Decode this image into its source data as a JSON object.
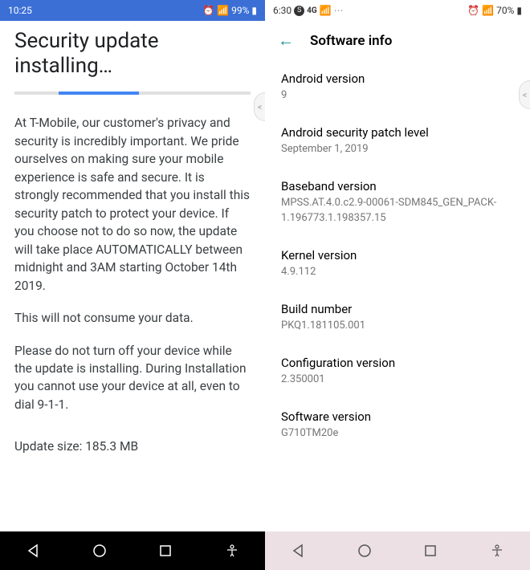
{
  "left": {
    "status": {
      "time": "10:25",
      "battery": "99%"
    },
    "title": "Security update installing…",
    "paragraphs": [
      "At T-Mobile, our customer's privacy and security is incredibly important. We pride ourselves on making sure your mobile experience is safe and secure. It is strongly recommended that you install this security patch to protect your device. If you choose not to do so now, the update will take place AUTOMATICALLY between midnight and 3AM starting October 14th 2019.",
      "This will not consume your data.",
      "Please do not turn off your device while the update is installing. During Installation you cannot use your device at all, even to dial 9-1-1."
    ],
    "update_size": "Update size: 185.3 MB"
  },
  "right": {
    "status": {
      "time": "6:30",
      "net": "4G",
      "battery": "70%"
    },
    "header": "Software info",
    "items": [
      {
        "label": "Android version",
        "value": "9"
      },
      {
        "label": "Android security patch level",
        "value": "September 1, 2019"
      },
      {
        "label": "Baseband version",
        "value": "MPSS.AT.4.0.c2.9-00061-SDM845_GEN_PACK-1.196773.1.198357.15"
      },
      {
        "label": "Kernel version",
        "value": "4.9.112"
      },
      {
        "label": "Build number",
        "value": "PKQ1.181105.001"
      },
      {
        "label": "Configuration version",
        "value": "2.350001"
      },
      {
        "label": "Software version",
        "value": "G710TM20e"
      }
    ]
  }
}
